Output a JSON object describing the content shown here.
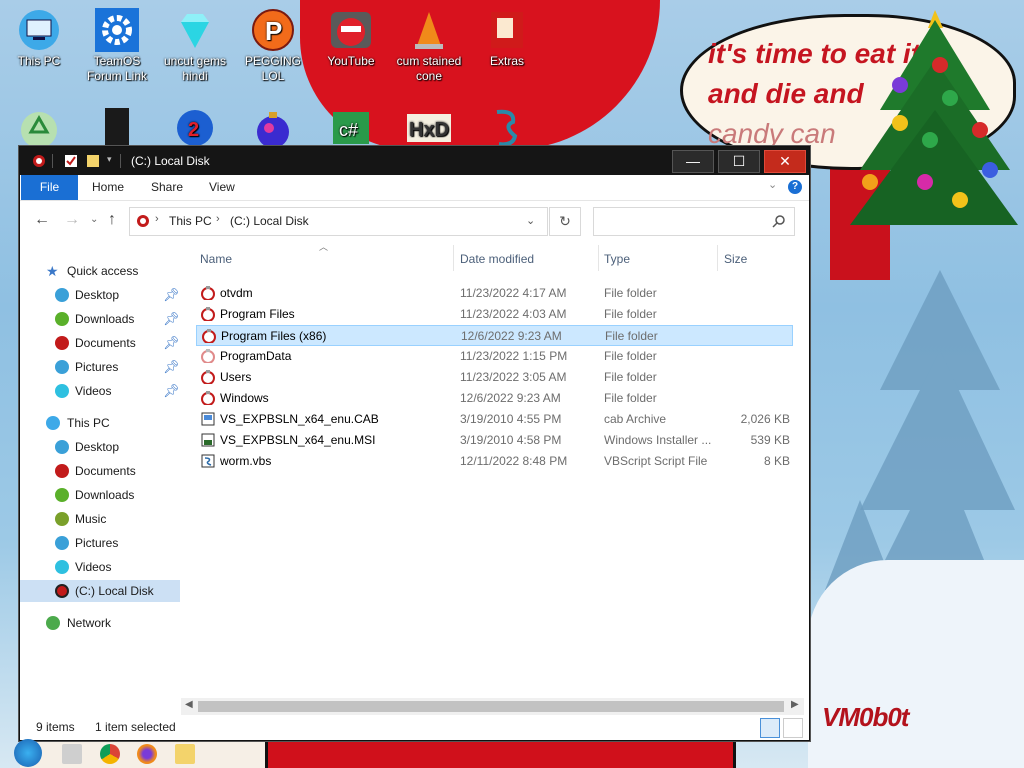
{
  "desktop": {
    "icons_row1": [
      {
        "label": "This PC",
        "icon": "computer-icon"
      },
      {
        "label": "TeamOS Forum Link",
        "icon": "gear-icon"
      },
      {
        "label": "uncut gems hindi",
        "icon": "diamond-icon"
      },
      {
        "label": "PEGGING LOL",
        "icon": "p-icon"
      },
      {
        "label": "YouTube",
        "icon": "angry-bird-icon"
      },
      {
        "label": "cum stained cone",
        "icon": "cone-icon"
      },
      {
        "label": "Extras",
        "icon": "book-icon"
      }
    ],
    "icons_row2": [
      {
        "icon": "recycle-bin-icon"
      },
      {
        "icon": "dark-box-icon"
      },
      {
        "icon": "blue-circle-icon"
      },
      {
        "icon": "ornament-icon"
      },
      {
        "icon": "csharp-icon"
      },
      {
        "icon": "hxd-icon"
      },
      {
        "icon": "script-icon"
      }
    ]
  },
  "wallpaper": {
    "bubble_line1": "it's time to eat it",
    "bubble_line2": "and die and",
    "bubble_line3": "candy can",
    "watermark": "VM0b0t",
    "colors": {
      "red": "#d0101b",
      "sky": "#9cc9e6"
    }
  },
  "window": {
    "title": "(C:) Local Disk",
    "ribbon_tabs": [
      "File",
      "Home",
      "Share",
      "View"
    ],
    "help": "?",
    "breadcrumb": [
      "This PC",
      "(C:) Local Disk"
    ],
    "search_placeholder": "",
    "columns": {
      "name": "Name",
      "date": "Date modified",
      "type": "Type",
      "size": "Size"
    },
    "nav": {
      "quick_access": "Quick access",
      "quick_items": [
        "Desktop",
        "Downloads",
        "Documents",
        "Pictures",
        "Videos"
      ],
      "this_pc": "This PC",
      "pc_items": [
        "Desktop",
        "Documents",
        "Downloads",
        "Music",
        "Pictures",
        "Videos",
        "(C:) Local Disk"
      ],
      "network": "Network"
    },
    "files": [
      {
        "name": "otvdm",
        "date": "11/23/2022 4:17 AM",
        "type": "File folder",
        "size": "",
        "icon": "folder-ornament-icon"
      },
      {
        "name": "Program Files",
        "date": "11/23/2022 4:03 AM",
        "type": "File folder",
        "size": "",
        "icon": "folder-ornament-icon"
      },
      {
        "name": "Program Files (x86)",
        "date": "12/6/2022 9:23 AM",
        "type": "File folder",
        "size": "",
        "icon": "folder-ornament-icon",
        "selected": true
      },
      {
        "name": "ProgramData",
        "date": "11/23/2022 1:15 PM",
        "type": "File folder",
        "size": "",
        "icon": "folder-ornament-icon"
      },
      {
        "name": "Users",
        "date": "11/23/2022 3:05 AM",
        "type": "File folder",
        "size": "",
        "icon": "folder-ornament-icon"
      },
      {
        "name": "Windows",
        "date": "12/6/2022 9:23 AM",
        "type": "File folder",
        "size": "",
        "icon": "folder-ornament-icon"
      },
      {
        "name": "VS_EXPBSLN_x64_enu.CAB",
        "date": "3/19/2010 4:55 PM",
        "type": "cab Archive",
        "size": "2,026 KB",
        "icon": "cab-file-icon"
      },
      {
        "name": "VS_EXPBSLN_x64_enu.MSI",
        "date": "3/19/2010 4:58 PM",
        "type": "Windows Installer ...",
        "size": "539 KB",
        "icon": "msi-file-icon"
      },
      {
        "name": "worm.vbs",
        "date": "12/11/2022 8:48 PM",
        "type": "VBScript Script File",
        "size": "8 KB",
        "icon": "vbs-file-icon"
      }
    ],
    "status_count": "9 items",
    "status_selected": "1 item selected"
  }
}
